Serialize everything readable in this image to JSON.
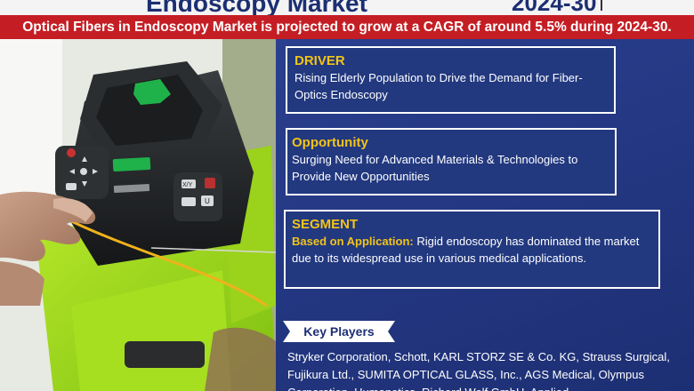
{
  "header": {
    "title": "Endoscopy Market",
    "years": "2024-30"
  },
  "banner": {
    "text": "Optical Fibers in Endoscopy Market is projected to grow at a CAGR of around 5.5% during 2024-30."
  },
  "photo": {
    "device_button_labels": [
      "X/Y",
      "U"
    ]
  },
  "driver": {
    "title": "DRIVER",
    "body": "Rising Elderly Population to Drive the Demand for Fiber-Optics Endoscopy"
  },
  "opportunity": {
    "title": "Opportunity",
    "body": "Surging Need for Advanced Materials & Technologies to Provide New Opportunities"
  },
  "segment": {
    "title": "SEGMENT",
    "highlight": "Based on Application:",
    "body": " Rigid endoscopy has dominated the market due to its widespread use in various medical applications."
  },
  "key_players": {
    "label": "Key Players",
    "text": "Stryker Corporation, Schott, KARL STORZ SE & Co. KG, Strauss Surgical, Fujikura Ltd., SUMITA OPTICAL GLASS, Inc., AGS Medical, Olympus Corporation, Humanetics, Richard Wolf GmbH, Applied"
  },
  "colors": {
    "banner": "#c41e24",
    "panel": "#22357f",
    "accent": "#f2c419",
    "title": "#1c2f72"
  }
}
